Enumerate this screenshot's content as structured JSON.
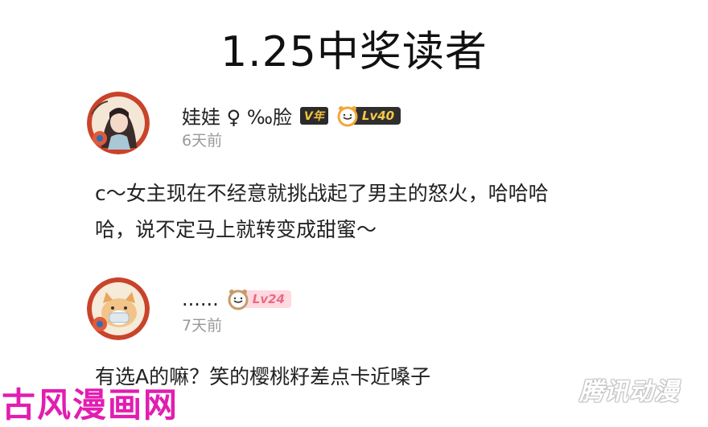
{
  "title": "1.25中奖读者",
  "comments": [
    {
      "username": "娃娃 ♀ ‰脸",
      "vip_badge": "V年",
      "level": "Lv40",
      "time": "6天前",
      "text": "c～女主现在不经意就挑战起了男主的怒火，哈哈哈\n哈，说不定马上就转变成甜蜜～",
      "avatar_icon": "anime-girl-avatar"
    },
    {
      "username": "......",
      "level": "Lv24",
      "time": "7天前",
      "text": "有选A的嘛？笑的樱桃籽差点卡近嗓子",
      "avatar_icon": "dog-avatar"
    }
  ],
  "watermarks": {
    "left": "古风漫画网",
    "right": "腾讯动漫"
  },
  "colors": {
    "watermark_left": "#e21db1",
    "level_gold": "#f7c948",
    "level_pink": "#ea6a83",
    "time_gray": "#999999"
  }
}
